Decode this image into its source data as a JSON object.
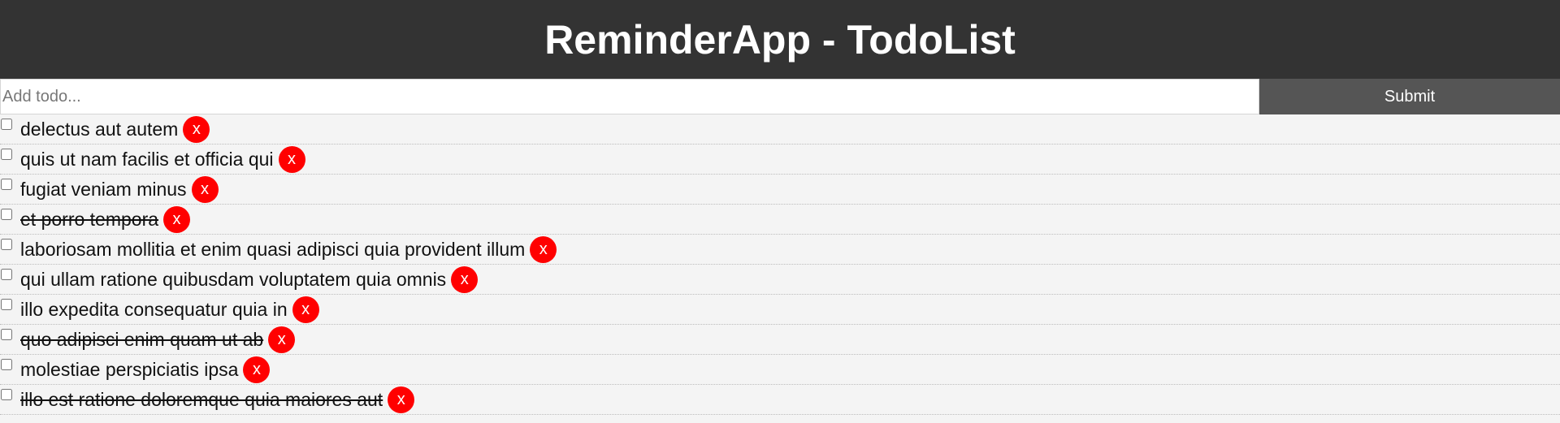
{
  "header": {
    "title": "ReminderApp - TodoList"
  },
  "form": {
    "placeholder": "Add todo...",
    "submit_label": "Submit"
  },
  "todos": [
    {
      "title": "delectus aut autem",
      "completed": false,
      "delete_label": "x"
    },
    {
      "title": "quis ut nam facilis et officia qui",
      "completed": false,
      "delete_label": "x"
    },
    {
      "title": "fugiat veniam minus",
      "completed": false,
      "delete_label": "x"
    },
    {
      "title": "et porro tempora",
      "completed": true,
      "delete_label": "x"
    },
    {
      "title": "laboriosam mollitia et enim quasi adipisci quia provident illum",
      "completed": false,
      "delete_label": "x"
    },
    {
      "title": "qui ullam ratione quibusdam voluptatem quia omnis",
      "completed": false,
      "delete_label": "x"
    },
    {
      "title": "illo expedita consequatur quia in",
      "completed": false,
      "delete_label": "x"
    },
    {
      "title": "quo adipisci enim quam ut ab",
      "completed": true,
      "delete_label": "x"
    },
    {
      "title": "molestiae perspiciatis ipsa",
      "completed": false,
      "delete_label": "x"
    },
    {
      "title": "illo est ratione doloremque quia maiores aut",
      "completed": true,
      "delete_label": "x"
    }
  ],
  "colors": {
    "header_bg": "#333333",
    "submit_bg": "#555555",
    "delete_bg": "#ff0000",
    "list_bg": "#f4f4f4"
  }
}
